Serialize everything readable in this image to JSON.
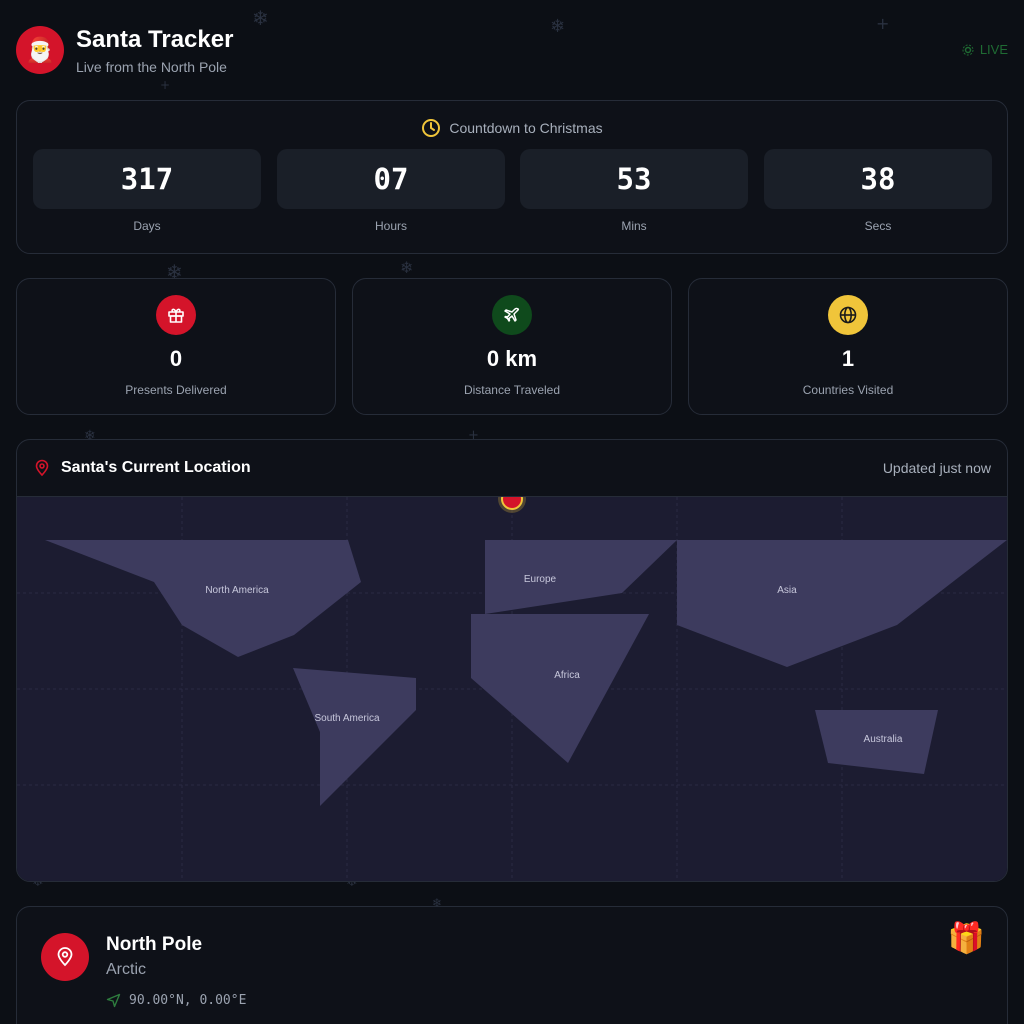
{
  "header": {
    "title": "Santa Tracker",
    "subtitle": "Live from the North Pole",
    "live_label": "LIVE",
    "logo_icon": "santa-emoji-icon"
  },
  "countdown": {
    "title": "Countdown to Christmas",
    "units": [
      {
        "value": "317",
        "label": "Days"
      },
      {
        "value": "07",
        "label": "Hours"
      },
      {
        "value": "53",
        "label": "Mins"
      },
      {
        "value": "38",
        "label": "Secs"
      }
    ]
  },
  "stats": [
    {
      "value": "0",
      "label": "Presents Delivered",
      "icon": "gift-icon",
      "color": "#d4142a"
    },
    {
      "value": "0 km",
      "label": "Distance Traveled",
      "icon": "plane-icon",
      "color": "#0f4a1c"
    },
    {
      "value": "1",
      "label": "Countries Visited",
      "icon": "globe-icon",
      "color": "#f0c53a"
    }
  ],
  "map": {
    "title": "Santa's Current Location",
    "updated": "Updated just now",
    "continents": [
      "North America",
      "Europe",
      "Asia",
      "Africa",
      "South America",
      "Australia"
    ]
  },
  "location": {
    "name": "North Pole",
    "region": "Arctic",
    "coords": "90.00°N, 0.00°E"
  },
  "colors": {
    "accent_red": "#d4142a",
    "live_green": "#1f6b33",
    "map_bg": "#1c1c31",
    "land": "#3d3b5e"
  }
}
